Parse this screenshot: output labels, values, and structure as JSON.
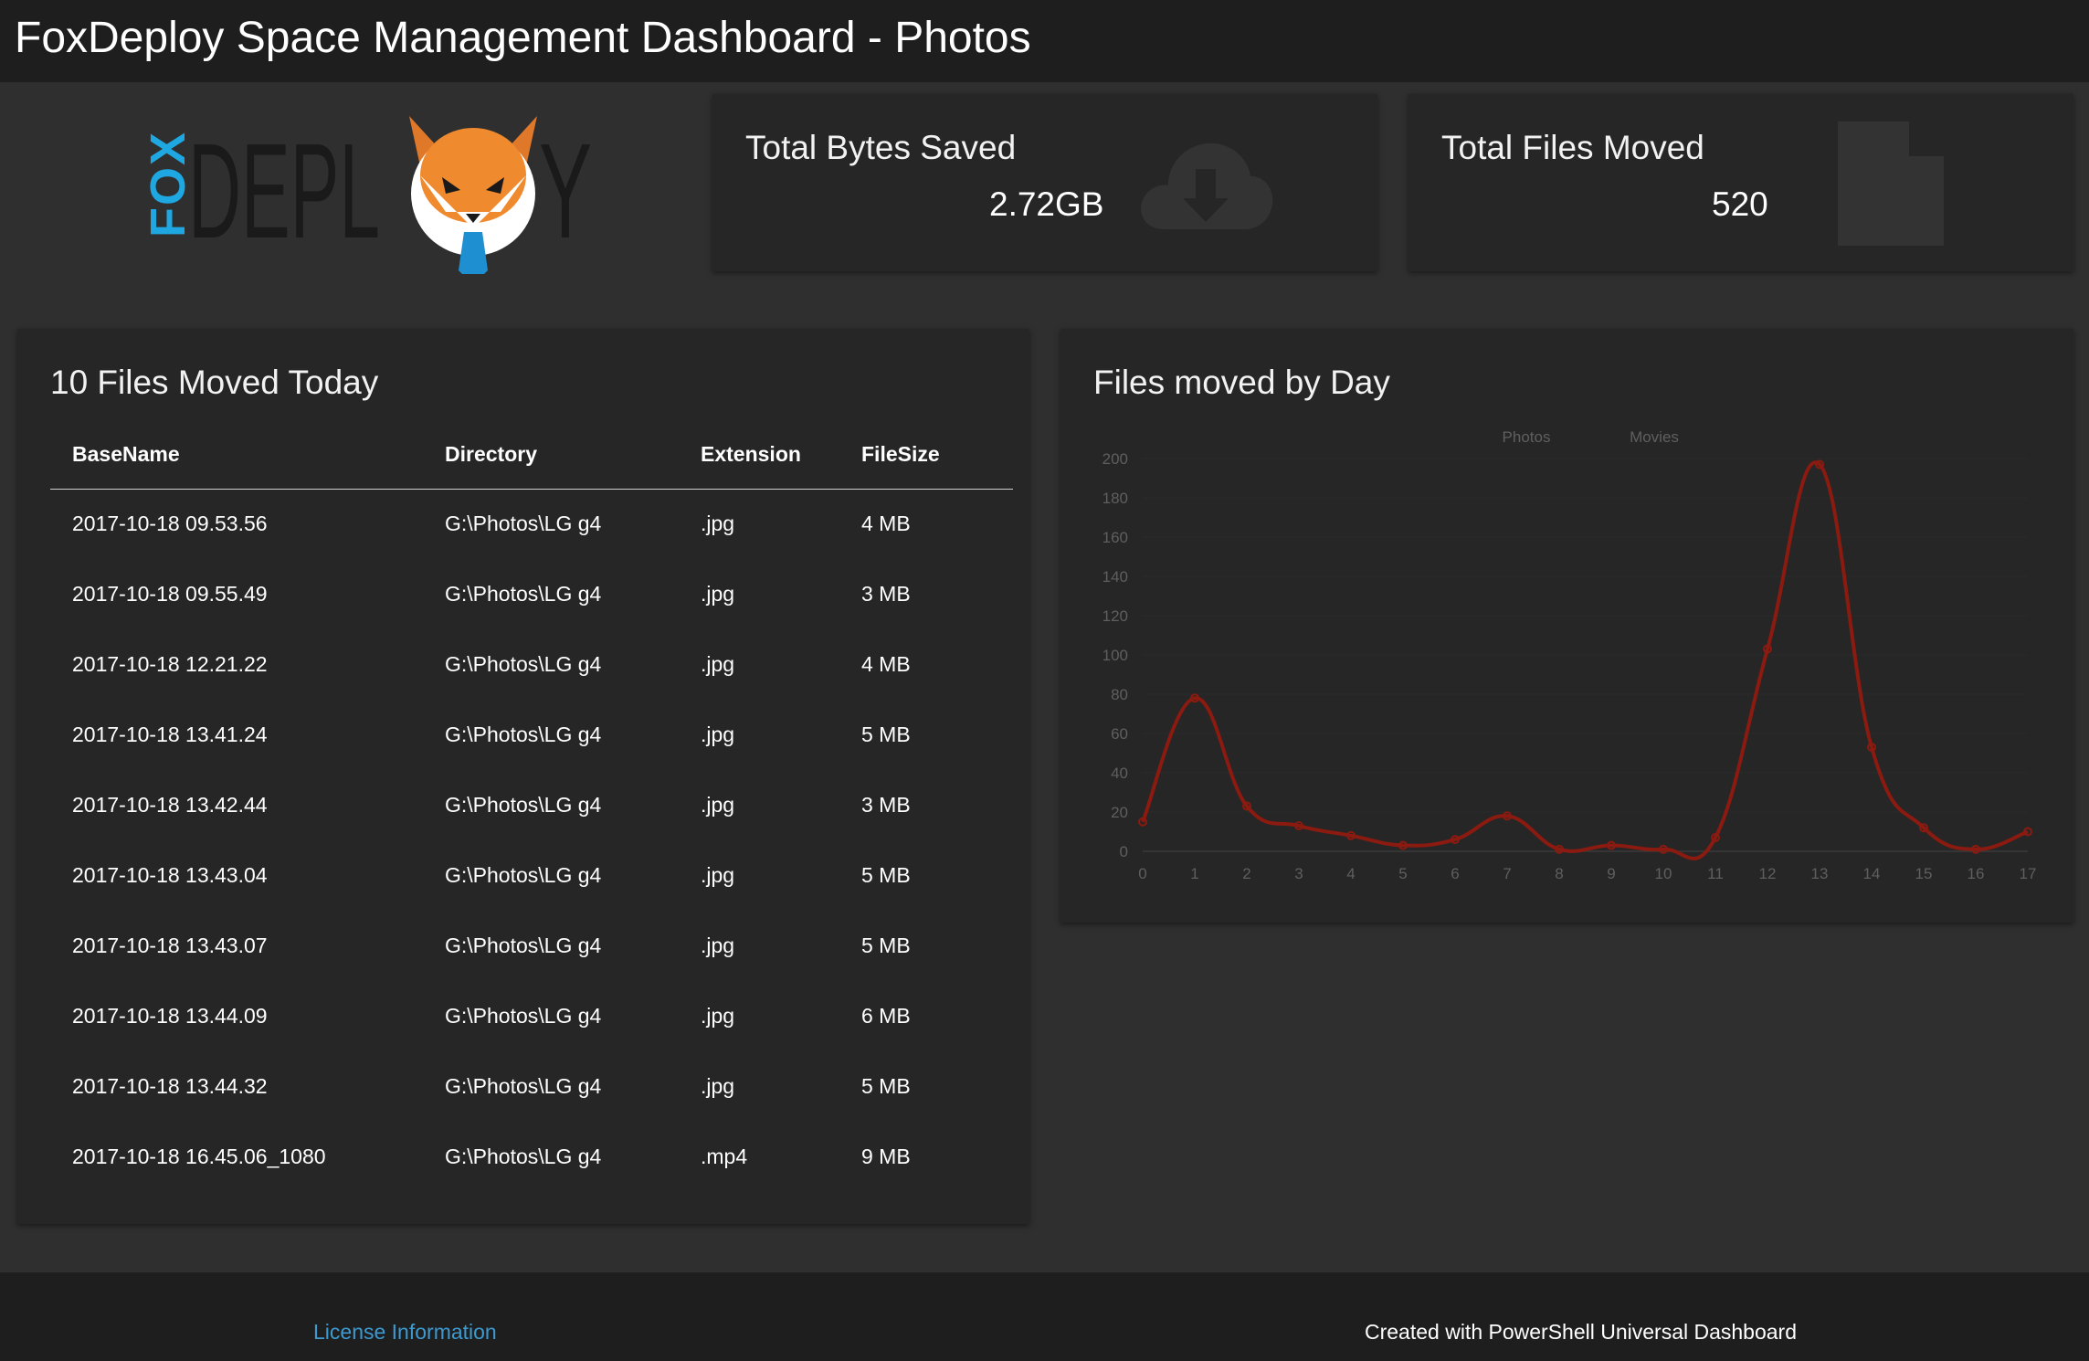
{
  "header": {
    "title": "FoxDeploy Space Management Dashboard - Photos"
  },
  "logo": {
    "text_fox": "FOX",
    "text_deploy": "DEPL",
    "text_end": "Y"
  },
  "counters": [
    {
      "title": "Total Bytes Saved",
      "value": "2.72GB",
      "icon": "cloud-download-icon"
    },
    {
      "title": "Total Files Moved",
      "value": "520",
      "icon": "file-icon"
    }
  ],
  "files_table": {
    "title": "10 Files Moved Today",
    "columns": [
      "BaseName",
      "Directory",
      "Extension",
      "FileSize"
    ],
    "rows": [
      [
        "2017-10-18 09.53.56",
        "G:\\Photos\\LG g4",
        ".jpg",
        "4 MB"
      ],
      [
        "2017-10-18 09.55.49",
        "G:\\Photos\\LG g4",
        ".jpg",
        "3 MB"
      ],
      [
        "2017-10-18 12.21.22",
        "G:\\Photos\\LG g4",
        ".jpg",
        "4 MB"
      ],
      [
        "2017-10-18 13.41.24",
        "G:\\Photos\\LG g4",
        ".jpg",
        "5 MB"
      ],
      [
        "2017-10-18 13.42.44",
        "G:\\Photos\\LG g4",
        ".jpg",
        "3 MB"
      ],
      [
        "2017-10-18 13.43.04",
        "G:\\Photos\\LG g4",
        ".jpg",
        "5 MB"
      ],
      [
        "2017-10-18 13.43.07",
        "G:\\Photos\\LG g4",
        ".jpg",
        "5 MB"
      ],
      [
        "2017-10-18 13.44.09",
        "G:\\Photos\\LG g4",
        ".jpg",
        "6 MB"
      ],
      [
        "2017-10-18 13.44.32",
        "G:\\Photos\\LG g4",
        ".jpg",
        "5 MB"
      ],
      [
        "2017-10-18 16.45.06_1080",
        "G:\\Photos\\LG g4",
        ".mp4",
        "9 MB"
      ]
    ]
  },
  "chart_card": {
    "title": "Files moved by Day"
  },
  "chart_data": {
    "type": "line",
    "title": "Files moved by Day",
    "xlabel": "",
    "ylabel": "",
    "x": [
      0,
      1,
      2,
      3,
      4,
      5,
      6,
      7,
      8,
      9,
      10,
      11,
      12,
      13,
      14,
      15,
      16,
      17
    ],
    "ylim": [
      0,
      200
    ],
    "yticks": [
      0,
      20,
      40,
      60,
      80,
      100,
      120,
      140,
      160,
      180,
      200
    ],
    "grid": true,
    "legend": "top-center",
    "series": [
      {
        "name": "Photos",
        "color": "#8b1a10",
        "values": [
          15,
          78,
          23,
          13,
          8,
          3,
          6,
          18,
          1,
          3,
          1,
          7,
          103,
          197,
          53,
          12,
          1,
          10
        ]
      },
      {
        "name": "Movies",
        "color": "#3a3a3a",
        "values": []
      }
    ]
  },
  "footer": {
    "license": "License Information",
    "created": "Created with PowerShell Universal Dashboard"
  }
}
